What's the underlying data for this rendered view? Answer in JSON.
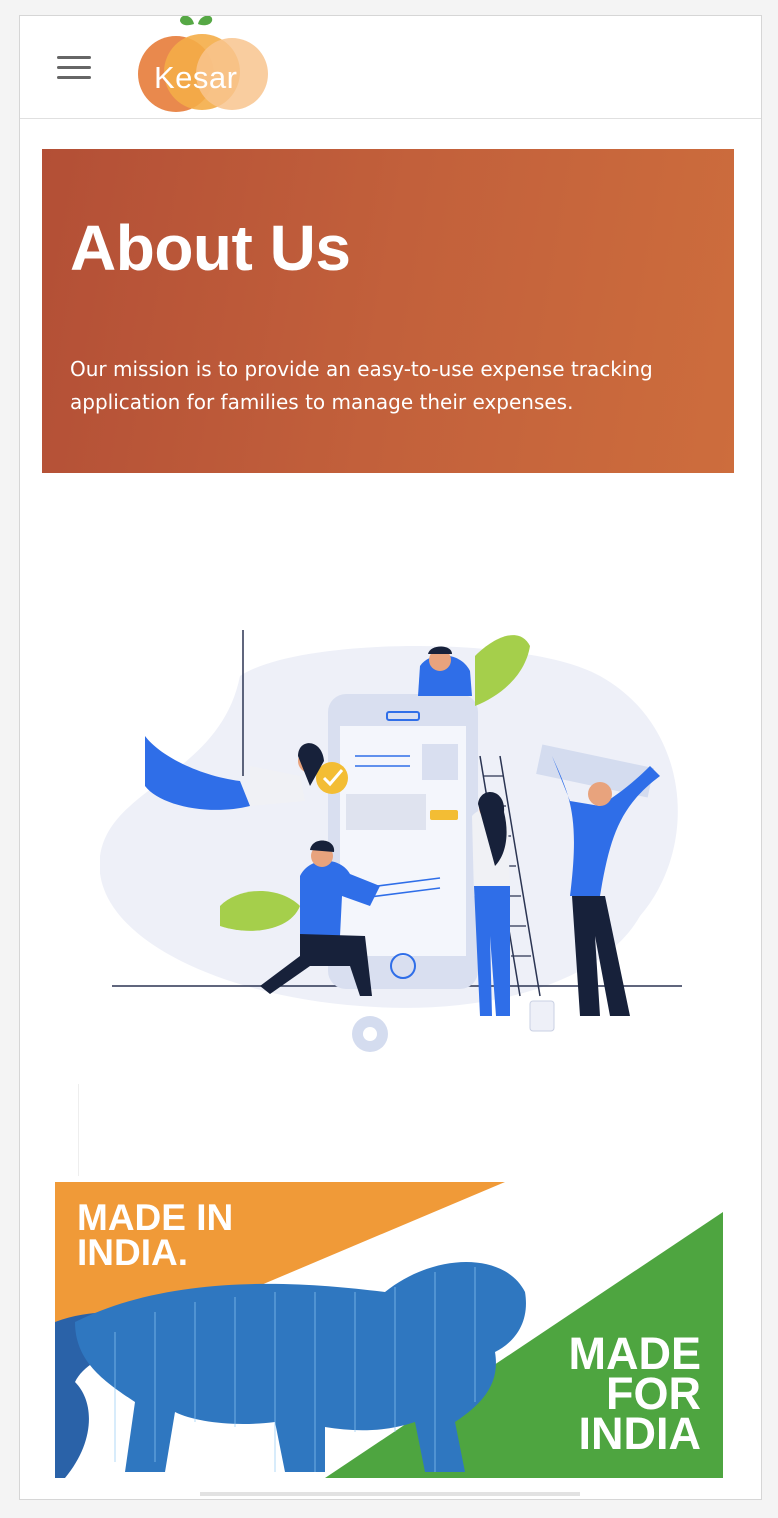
{
  "header": {
    "menu_icon": "hamburger-menu-icon",
    "logo_text": "Kesar"
  },
  "hero": {
    "title": "About Us",
    "mission": "Our mission is to provide an easy-to-use expense tracking application for families to manage their expenses."
  },
  "illustration": {
    "icon": "team-building-app-illustration"
  },
  "banner": {
    "left_text": "MADE IN INDIA.",
    "right_text": "MADE FOR INDIA"
  },
  "colors": {
    "hero_start": "#b34f36",
    "hero_end": "#cd6d3d",
    "orange": "#f09a38",
    "green": "#4ea540",
    "blue_accent": "#2f6ee8"
  }
}
